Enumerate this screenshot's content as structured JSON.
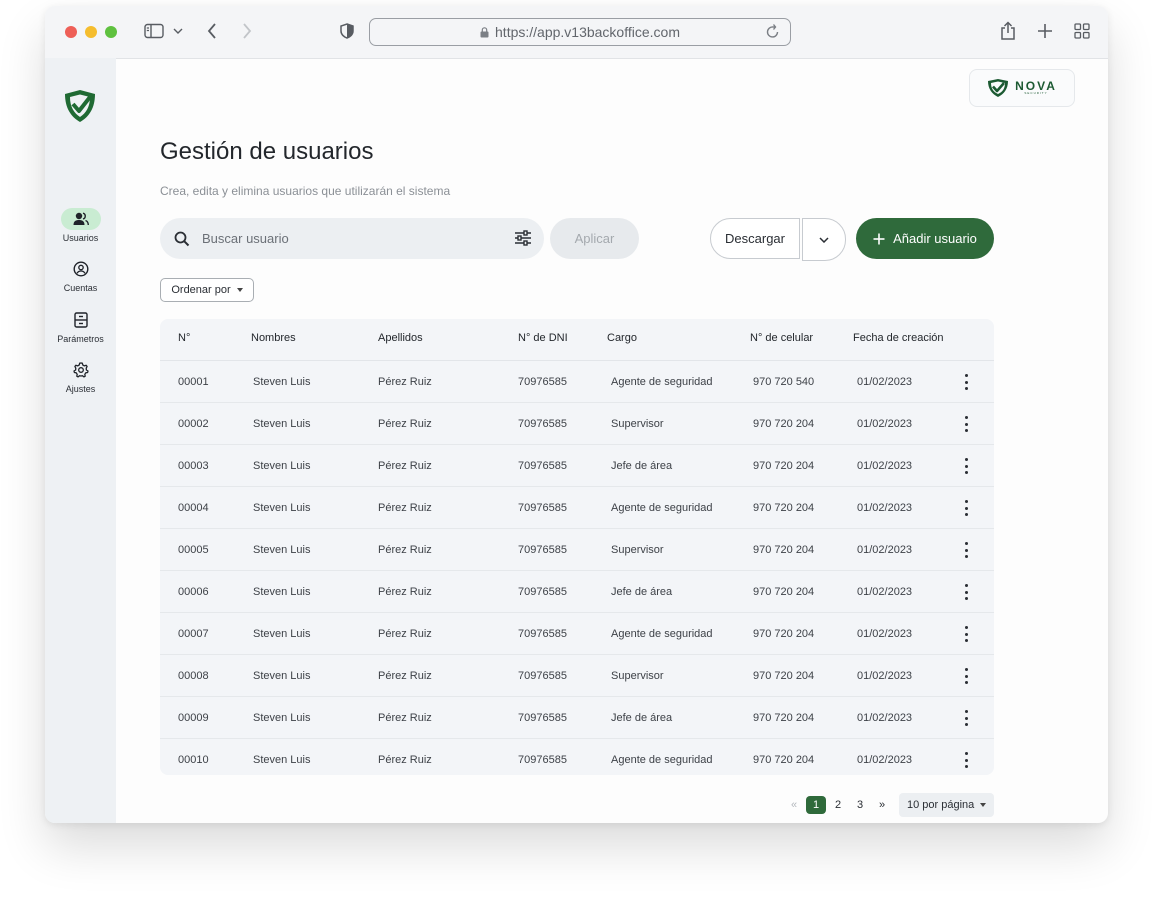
{
  "browser": {
    "url": "https://app.v13backoffice.com"
  },
  "sidebar": {
    "items": [
      {
        "label": "Usuarios",
        "icon": "users-icon",
        "active": true
      },
      {
        "label": "Cuentas",
        "icon": "account-circle-icon",
        "active": false
      },
      {
        "label": "Parámetros",
        "icon": "archive-icon",
        "active": false
      },
      {
        "label": "Ajustes",
        "icon": "gear-icon",
        "active": false
      }
    ]
  },
  "brand": {
    "name": "NOVA",
    "tagline": "SECURITY"
  },
  "page": {
    "title": "Gestión de usuarios",
    "subtitle": "Crea, edita y elimina usuarios que utilizarán el sistema"
  },
  "toolbar": {
    "search_placeholder": "Buscar usuario",
    "apply_label": "Aplicar",
    "download_label": "Descargar",
    "add_label": "Añadir usuario",
    "sort_label": "Ordenar por"
  },
  "table": {
    "headers": [
      "N°",
      "Nombres",
      "Apellidos",
      "N° de DNI",
      "Cargo",
      "N° de celular",
      "Fecha de creación"
    ],
    "rows": [
      [
        "00001",
        "Steven Luis",
        "Pérez Ruiz",
        "70976585",
        "Agente de seguridad",
        "970 720 540",
        "01/02/2023"
      ],
      [
        "00002",
        "Steven Luis",
        "Pérez Ruiz",
        "70976585",
        "Supervisor",
        "970 720 204",
        "01/02/2023"
      ],
      [
        "00003",
        "Steven Luis",
        "Pérez Ruiz",
        "70976585",
        "Jefe de área",
        "970 720 204",
        "01/02/2023"
      ],
      [
        "00004",
        "Steven Luis",
        "Pérez Ruiz",
        "70976585",
        "Agente de seguridad",
        "970 720 204",
        "01/02/2023"
      ],
      [
        "00005",
        "Steven Luis",
        "Pérez Ruiz",
        "70976585",
        "Supervisor",
        "970 720 204",
        "01/02/2023"
      ],
      [
        "00006",
        "Steven Luis",
        "Pérez Ruiz",
        "70976585",
        "Jefe de área",
        "970 720 204",
        "01/02/2023"
      ],
      [
        "00007",
        "Steven Luis",
        "Pérez Ruiz",
        "70976585",
        "Agente de seguridad",
        "970 720 204",
        "01/02/2023"
      ],
      [
        "00008",
        "Steven Luis",
        "Pérez Ruiz",
        "70976585",
        "Supervisor",
        "970 720 204",
        "01/02/2023"
      ],
      [
        "00009",
        "Steven Luis",
        "Pérez Ruiz",
        "70976585",
        "Jefe de área",
        "970 720 204",
        "01/02/2023"
      ],
      [
        "00010",
        "Steven Luis",
        "Pérez Ruiz",
        "70976585",
        "Agente de seguridad",
        "970 720 204",
        "01/02/2023"
      ]
    ]
  },
  "pagination": {
    "first": "«",
    "pages": [
      "1",
      "2",
      "3"
    ],
    "current": "1",
    "last": "»",
    "per_page_label": "10 por página"
  },
  "colors": {
    "accent": "#2f6a3b",
    "active_nav": "#c9ecd2",
    "sidebar_bg": "#eef1f4",
    "table_bg": "#f3f5f8"
  }
}
